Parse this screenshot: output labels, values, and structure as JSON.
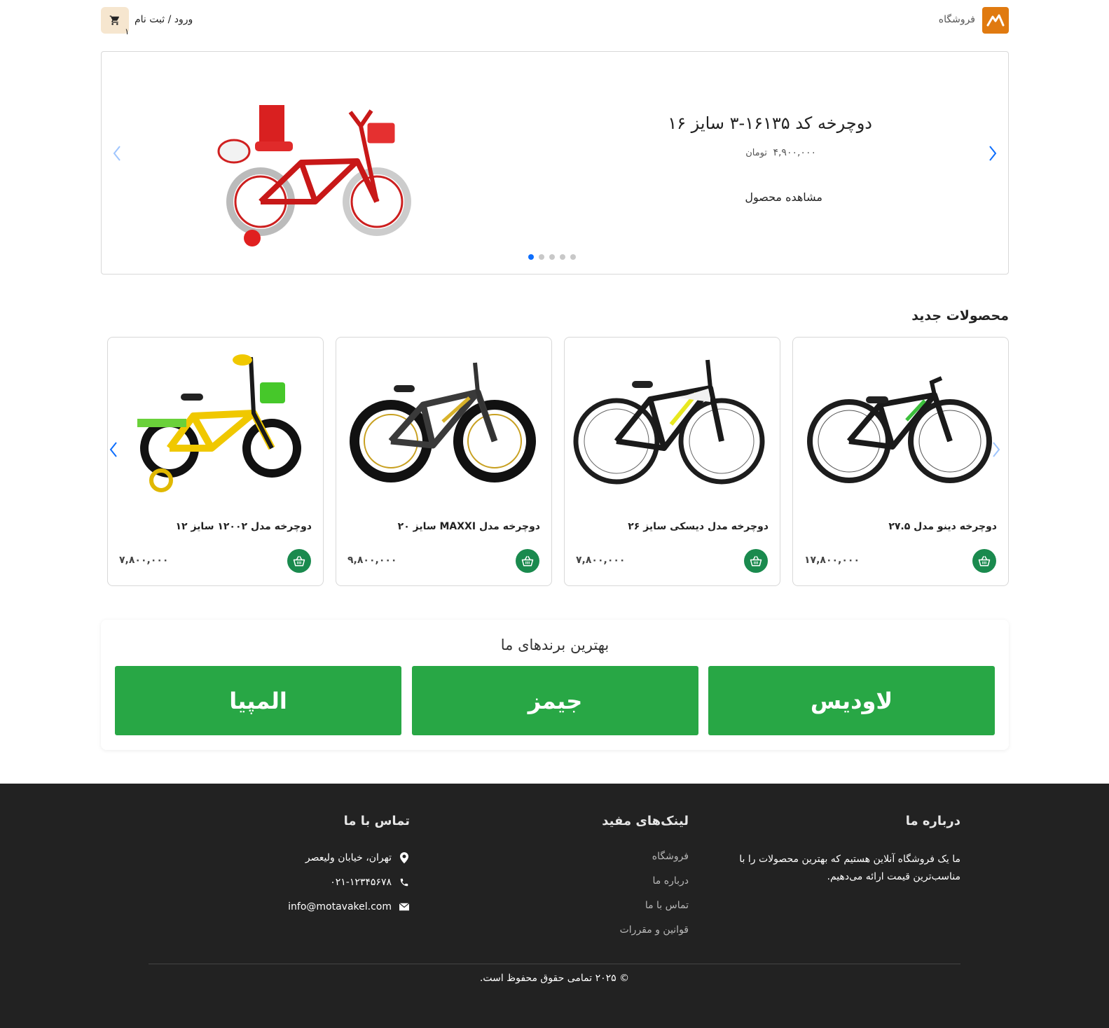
{
  "header": {
    "store_label": "فروشگاه",
    "login_label": "ورود / ثبت نام",
    "cart_count": "۱"
  },
  "slider": {
    "title": "دوچرخه کد ۱۶۱۳۵-۳ سایز ۱۶",
    "price": "۴,۹۰۰,۰۰۰",
    "price_unit": "تومان",
    "cta": "مشاهده محصول",
    "dots_total": 5,
    "active_dot": 1
  },
  "new_products": {
    "title": "محصولات جدید",
    "items": [
      {
        "name": "دوچرخه دینو مدل ۲۷.۵",
        "price": "۱۷,۸۰۰,۰۰۰",
        "image_icon": "mtb-bike-dark-green"
      },
      {
        "name": "دوچرخه مدل دیسکی سایز ۲۶",
        "price": "۷,۸۰۰,۰۰۰",
        "image_icon": "mtb-bike-black-yellow"
      },
      {
        "name": "دوچرخه مدل MAXXI سایز ۲۰",
        "price": "۹,۸۰۰,۰۰۰",
        "image_icon": "fat-tire-bike-gray"
      },
      {
        "name": "دوچرخه مدل ۱۲۰۰۲ سایز ۱۲",
        "price": "۷,۸۰۰,۰۰۰",
        "image_icon": "kids-bike-yellow"
      }
    ]
  },
  "brands": {
    "title": "بهترین برندهای ما",
    "items": [
      "لاودیس",
      "جیمز",
      "المپیا"
    ]
  },
  "footer": {
    "about_title": "درباره ما",
    "about_text": "ما یک فروشگاه آنلاین هستیم که بهترین محصولات را با مناسب‌ترین قیمت ارائه می‌دهیم.",
    "links_title": "لینک‌های مفید",
    "links": [
      "فروشگاه",
      "درباره ما",
      "تماس با ما",
      "قوانین و مقررات"
    ],
    "contact_title": "تماس با ما",
    "address": "تهران، خیابان ولیعصر",
    "phone": "۰۲۱-۱۲۳۴۵۶۷۸",
    "email": "info@motavakel.com",
    "copyright": "© ۲۰۲۵ تمامی حقوق محفوظ است."
  },
  "colors": {
    "brand_orange": "#e07a10",
    "brand_tile_green": "#28a745",
    "cart_button_green": "#1a8a4e",
    "active_dot_blue": "#0d6efd",
    "footer_bg": "#222222"
  }
}
